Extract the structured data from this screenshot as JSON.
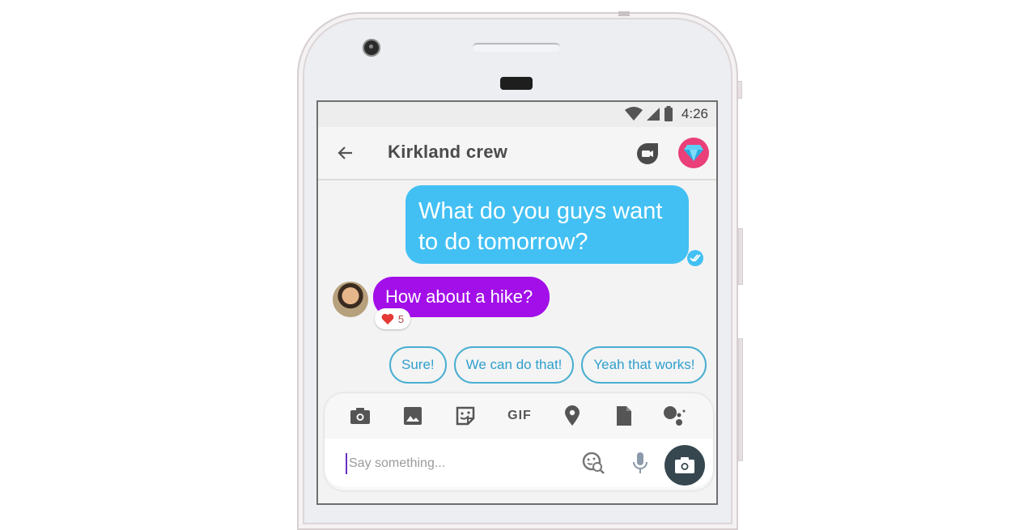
{
  "status_bar": {
    "time": "4:26",
    "icons": [
      "wifi-icon",
      "signal-icon",
      "battery-icon"
    ]
  },
  "app_bar": {
    "back_icon": "arrow-left-icon",
    "title": "Kirkland crew",
    "actions": [
      {
        "name": "video-call-button",
        "icon": "duo-video-icon"
      },
      {
        "name": "group-avatar-button",
        "icon": "diamond-icon"
      }
    ]
  },
  "messages": [
    {
      "direction": "outgoing",
      "text_lines": [
        "What do you guys want",
        "to do tomorrow?"
      ],
      "status_icon": "read-receipt-icon",
      "color": "#42c0f3"
    },
    {
      "direction": "incoming",
      "text": "How about a hike?",
      "color": "#a20fe9",
      "reaction": {
        "icon": "heart-icon",
        "count": "5"
      }
    }
  ],
  "smart_replies": [
    "Sure!",
    "We can do that!",
    "Yeah that works!"
  ],
  "composer": {
    "tools": [
      "camera-icon",
      "image-icon",
      "sticker-icon",
      "GIF",
      "location-icon",
      "file-icon",
      "assistant-icon"
    ],
    "placeholder": "Say something...",
    "value": ""
  },
  "colors": {
    "outgoing_bubble": "#42c0f3",
    "incoming_bubble": "#a20fe9",
    "chip_border": "#49aed0",
    "fab": "#37474f",
    "group_avatar": "#ea3f78"
  }
}
